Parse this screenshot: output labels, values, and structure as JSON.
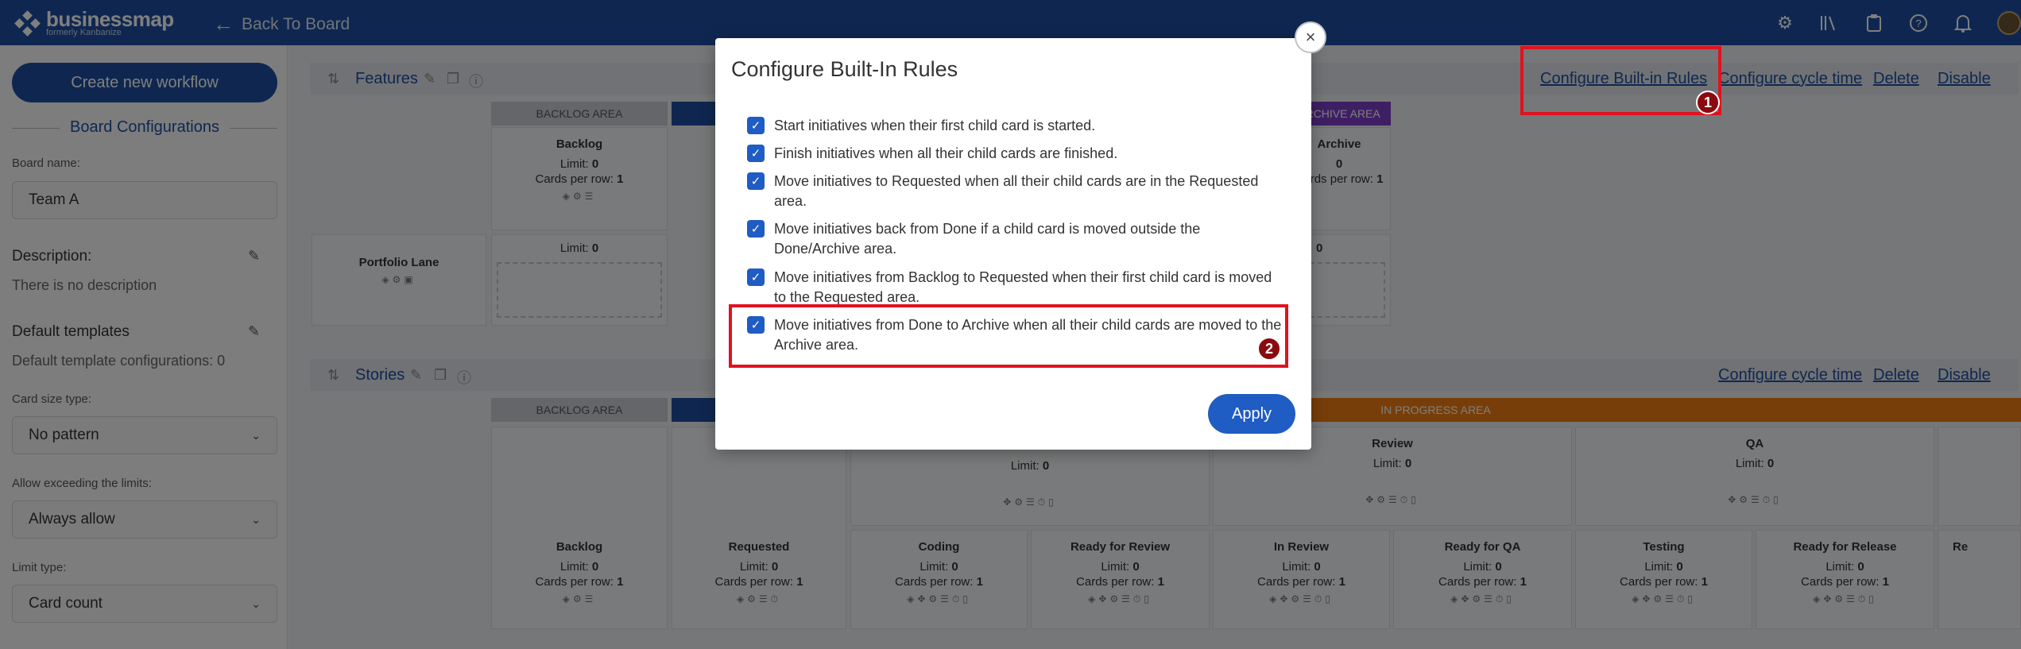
{
  "topbar": {
    "logo_text": "businessmap",
    "logo_sub": "formerly Kanbanize",
    "back_label": "Back To Board",
    "icons": [
      "gear-icon",
      "library-icon",
      "clipboard-icon",
      "help-icon",
      "bell-icon",
      "avatar"
    ]
  },
  "sidebar": {
    "create_button": "Create new workflow",
    "board_config_title": "Board Configurations",
    "board_name_label": "Board name:",
    "board_name_value": "Team A",
    "description_label": "Description:",
    "description_value": "There is no description",
    "templates_label": "Default templates",
    "templates_value": "Default template configurations: 0",
    "card_size_label": "Card size type:",
    "card_size_value": "No pattern",
    "allow_exceed_label": "Allow exceeding the limits:",
    "allow_exceed_value": "Always allow",
    "limit_type_label": "Limit type:",
    "limit_type_value": "Card count"
  },
  "board": {
    "features": {
      "title": "Features",
      "links": {
        "configure_rules": "Configure Built-in Rules",
        "configure_cycle": "Configure cycle time",
        "delete": "Delete",
        "disable": "Disable"
      },
      "area_backlog": "BACKLOG AREA",
      "area_archive": "ARCHIVE AREA",
      "col_backlog": "Backlog",
      "col_archive": "Archive",
      "limit_text": "Limit:",
      "limit_value": "0",
      "cards_per_row_text": "Cards per row:",
      "cards_per_row_value": "1",
      "lane_name": "Portfolio Lane"
    },
    "stories": {
      "title": "Stories",
      "links": {
        "configure_cycle": "Configure cycle time",
        "delete": "Delete",
        "disable": "Disable"
      },
      "area_backlog": "BACKLOG AREA",
      "area_in_progress": "IN PROGRESS AREA",
      "parent_columns": [
        "Review",
        "QA"
      ],
      "columns": [
        "Backlog",
        "Requested",
        "Coding",
        "Ready for Review",
        "In Review",
        "Ready for QA",
        "Testing",
        "Ready for Release",
        "Re"
      ],
      "limit_text": "Limit:",
      "limit_value": "0",
      "cards_per_row_text": "Cards per row:",
      "cards_per_row_value": "1"
    }
  },
  "modal": {
    "title": "Configure Built-In Rules",
    "rules": [
      {
        "text": "Start initiatives when their first child card is started.",
        "checked": true
      },
      {
        "text": "Finish initiatives when all their child cards are finished.",
        "checked": true
      },
      {
        "text": "Move initiatives to Requested when all their child cards are in the Requested area.",
        "checked": true
      },
      {
        "text": "Move initiatives back from Done if a child card is moved outside the Done/Archive area.",
        "checked": true
      },
      {
        "text": "Move initiatives from Backlog to Requested when their first child card is moved to the Requested area.",
        "checked": true
      },
      {
        "text": "Move initiatives from Done to Archive when all their child cards are moved to the Archive area.",
        "checked": true
      }
    ],
    "apply_label": "Apply",
    "close_label": "×"
  },
  "callouts": [
    {
      "number": "1"
    },
    {
      "number": "2"
    }
  ],
  "colors": {
    "brand": "#1f4fa0",
    "accent": "#1f5cc4",
    "callout": "#e0121f",
    "in_progress_area": "#f07c12",
    "archive_area": "#7c3fc9"
  }
}
